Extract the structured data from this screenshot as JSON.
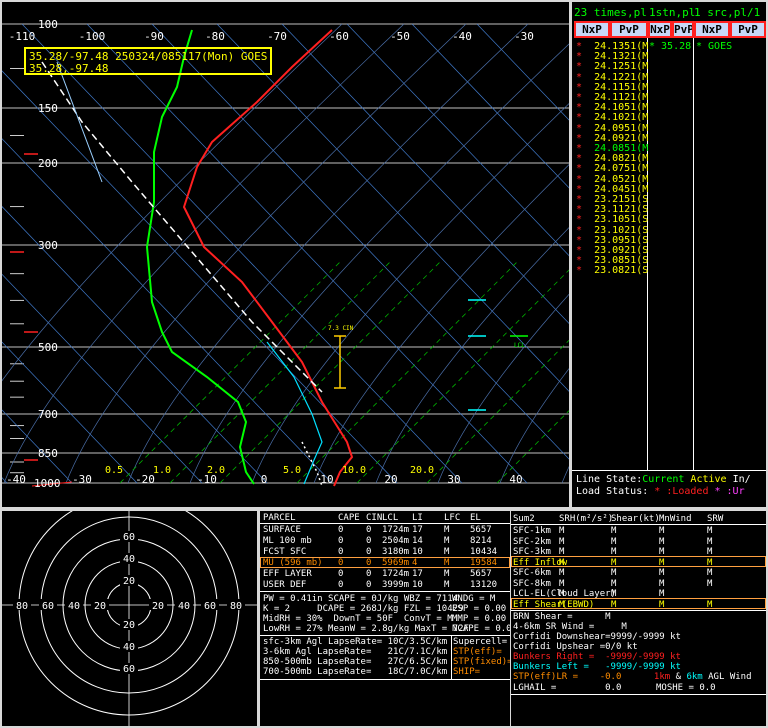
{
  "skewt": {
    "info_line1": "35.28/-97.48 250324/085117(Mon) GOES",
    "info_line2": "35.28,-97.48",
    "temp_labels": [
      "-110",
      "-100",
      "-90",
      "-80",
      "-70",
      "-60",
      "-50",
      "-40",
      "-30"
    ],
    "bottom_temp_labels": [
      "-40",
      "-30",
      "-20",
      "-10",
      "0",
      "10",
      "20",
      "30",
      "40"
    ],
    "pressure_labels": [
      "100",
      "150",
      "200",
      "300",
      "500",
      "700",
      "850",
      "1000"
    ],
    "mixing_ratio_labels": [
      "0.5",
      "1.0",
      "2.0",
      "5.0",
      "10.0",
      "20.0"
    ],
    "annotations": {
      "el_label": "7.3 CIN",
      "lcl_label": "LCL",
      "lfc_label": "LFC"
    },
    "colors": {
      "temperature": "#ff2020",
      "dewpoint": "#00ff00",
      "parcel": "#ffffff",
      "wetbulb": "#00ffff",
      "isotherm": "#4aa0ff",
      "mixratio": "#00cc00",
      "box": "#ffff00"
    }
  },
  "times_panel": {
    "header": [
      "23 times,pl",
      "1stn,pl",
      "1 src,pl/1"
    ],
    "buttons": [
      "NxP",
      "PvP",
      "NxP",
      "PvP",
      "NxP",
      "PvP"
    ],
    "times": [
      {
        "mark": "*",
        "label": "24.1351(M",
        "c": "y"
      },
      {
        "mark": "*",
        "label": "24.1321(M",
        "c": "y"
      },
      {
        "mark": "*",
        "label": "24.1251(M",
        "c": "y"
      },
      {
        "mark": "*",
        "label": "24.1221(M",
        "c": "y"
      },
      {
        "mark": "*",
        "label": "24.1151(M",
        "c": "y"
      },
      {
        "mark": "*",
        "label": "24.1121(M",
        "c": "y"
      },
      {
        "mark": "*",
        "label": "24.1051(M",
        "c": "y"
      },
      {
        "mark": "*",
        "label": "24.1021(M",
        "c": "y"
      },
      {
        "mark": "*",
        "label": "24.0951(M",
        "c": "y"
      },
      {
        "mark": "*",
        "label": "24.0921(M",
        "c": "y"
      },
      {
        "mark": "*",
        "label": "24.0851(M",
        "c": "g"
      },
      {
        "mark": "*",
        "label": "24.0821(M",
        "c": "y"
      },
      {
        "mark": "*",
        "label": "24.0751(M",
        "c": "y"
      },
      {
        "mark": "*",
        "label": "24.0521(M",
        "c": "y"
      },
      {
        "mark": "*",
        "label": "24.0451(M",
        "c": "y"
      },
      {
        "mark": "*",
        "label": "23.2151(S",
        "c": "y"
      },
      {
        "mark": "*",
        "label": "23.1121(S",
        "c": "y"
      },
      {
        "mark": "*",
        "label": "23.1051(S",
        "c": "y"
      },
      {
        "mark": "*",
        "label": "23.1021(S",
        "c": "y"
      },
      {
        "mark": "*",
        "label": "23.0951(S",
        "c": "y"
      },
      {
        "mark": "*",
        "label": "23.0921(S",
        "c": "y"
      },
      {
        "mark": "*",
        "label": "23.0851(S",
        "c": "y"
      },
      {
        "mark": "*",
        "label": "23.0821(S",
        "c": "y"
      }
    ],
    "station": "* 35.28",
    "source": "* GOES",
    "line_state_label": "Line State:",
    "line_state_current": "Current",
    "line_state_active": "Active",
    "line_state_rest": "In/",
    "load_status_label": "Load Status:",
    "load_status_loaded": "* :Loaded",
    "load_status_un": "* :Ur"
  },
  "hodograph": {
    "ring_labels": [
      "80",
      "60",
      "40",
      "20",
      "20",
      "40",
      "60",
      "80"
    ],
    "vert_labels": [
      "60",
      "40",
      "20",
      "20",
      "40",
      "60"
    ]
  },
  "parcel_table": {
    "headers": [
      "PARCEL",
      "CAPE",
      "CIN",
      "LCL",
      "LI",
      "LFC",
      "EL"
    ],
    "rows": [
      {
        "name": "SURFACE",
        "cape": "0",
        "cin": "0",
        "lcl": "1724m",
        "li": "17",
        "lfc": "M",
        "el": "5657",
        "sel": false
      },
      {
        "name": "ML 100 mb",
        "cape": "0",
        "cin": "0",
        "lcl": "2504m",
        "li": "14",
        "lfc": "M",
        "el": "8214",
        "sel": false
      },
      {
        "name": "FCST SFC",
        "cape": "0",
        "cin": "0",
        "lcl": "3180m",
        "li": "10",
        "lfc": "M",
        "el": "10434",
        "sel": false
      },
      {
        "name": "MU (596 mb)",
        "cape": "0",
        "cin": "0",
        "lcl": "5969m",
        "li": "4",
        "lfc": "M",
        "el": "19584",
        "sel": true
      },
      {
        "name": "EFF LAYER",
        "cape": "0",
        "cin": "0",
        "lcl": "1724m",
        "li": "17",
        "lfc": "M",
        "el": "5657",
        "sel": false
      },
      {
        "name": "USER DEF",
        "cape": "0",
        "cin": "0",
        "lcl": "3999m",
        "li": "10",
        "lfc": "M",
        "el": "13120",
        "sel": false
      }
    ],
    "indices": [
      "PW = 0.41in SCAPE = 0J/kg WBZ = 7114",
      "K = 2     DCAPE = 268J/kg FZL = 10429",
      "MidRH = 30%  DownT = 50F  ConvT = M",
      "LowRH = 27% MeanW = 2.8g/kg MaxT = 72F"
    ],
    "indices_right": [
      "WNDG = M",
      "ESP = 0.00",
      "MMP = 0.00",
      "NCAPE = 0.00"
    ],
    "lapse_rates": [
      "sfc-3km Agl LapseRate= 10C/3.5C/km",
      "3-6km Agl LapseRate=   21C/7.1C/km",
      "850-500mb LapseRate=   27C/6.5C/km",
      "700-500mb LapseRate=   18C/7.0C/km"
    ],
    "composite": [
      "Supercell=",
      "STP(eff)=",
      "STP(fixed)=",
      "SHIP="
    ]
  },
  "storm_table": {
    "headers": [
      "Sum2",
      "SRH(m²/s²)",
      "Shear(kt)",
      "MnWind",
      "SRW"
    ],
    "rows": [
      {
        "name": "SFC-1km",
        "c": "w",
        "vals": [
          "M",
          "M",
          "M",
          "M"
        ]
      },
      {
        "name": "SFC-2km",
        "c": "w",
        "vals": [
          "M",
          "M",
          "M",
          "M"
        ]
      },
      {
        "name": "SFC-3km",
        "c": "w",
        "vals": [
          "M",
          "M",
          "M",
          "M"
        ]
      },
      {
        "name": "Eff Inflow",
        "c": "y",
        "vals": [
          "M",
          "M",
          "M",
          "M"
        ]
      },
      {
        "name": "SFC-6km",
        "c": "w",
        "vals": [
          "M",
          "M",
          "M",
          "M"
        ]
      },
      {
        "name": "SFC-8km",
        "c": "w",
        "vals": [
          "M",
          "M",
          "M",
          "M"
        ]
      },
      {
        "name": "LCL-EL(Cloud Layer)",
        "c": "w",
        "vals": [
          "M",
          "M",
          "M",
          ""
        ]
      },
      {
        "name": "Eff Shear(EBWD)",
        "c": "y",
        "vals": [
          "M",
          "M",
          "M",
          "M"
        ]
      }
    ],
    "brn_shear": "BRN Shear =      M",
    "sr_wind": "4-6km SR Wind =     M",
    "corfidi_down": "Corfidi Downshear=9999/-9999 kt",
    "corfidi_up": "Corfidi Upshear =0/0 kt",
    "bunkers_right": "Bunkers Right =  -9999/-9999 kt",
    "bunkers_left": "Bunkers Left =   -9999/-9999 kt",
    "stp_label": "STP(eff)LR =",
    "stp_value": "-0.0",
    "stp_tail_1": "1km",
    "stp_tail_amp": "&",
    "stp_tail_2": "6km",
    "stp_tail_3": "AGL Wind",
    "lghail": "LGHAIL =         0.0",
    "moshe": "MOSHE = 0.0"
  }
}
